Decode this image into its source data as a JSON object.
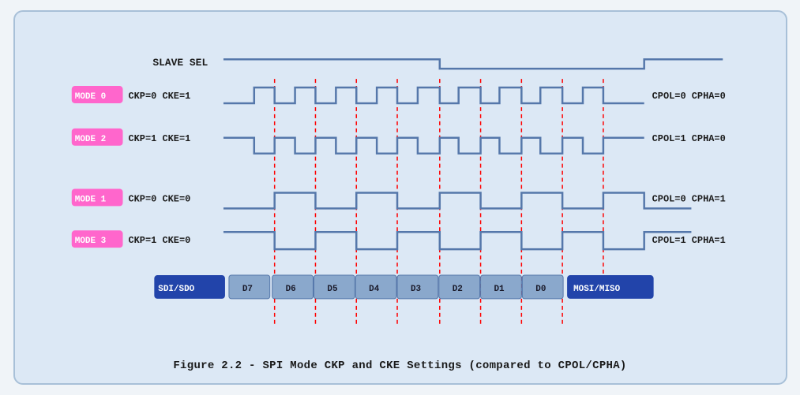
{
  "caption": "Figure 2.2 - SPI Mode CKP and CKE Settings (compared to CPOL/CPHA)",
  "diagram": {
    "slave_sel_label": "SLAVE SEL",
    "mode0_label": "MODE 0",
    "mode0_params": "CKP=0  CKE=1",
    "mode0_right": "CPOL=0  CPHA=0",
    "mode2_label": "MODE 2",
    "mode2_params": "CKP=1  CKE=1",
    "mode2_right": "CPOL=1  CPHA=0",
    "mode1_label": "MODE 1",
    "mode1_params": "CKP=0  CKE=0",
    "mode1_right": "CPOL=0  CPHA=1",
    "mode3_label": "MODE 3",
    "mode3_params": "CKP=1  CKE=0",
    "mode3_right": "CPOL=1  CPHA=1",
    "data_bits": [
      "SDI/SDO",
      "D7",
      "D6",
      "D5",
      "D4",
      "D3",
      "D2",
      "D1",
      "D0",
      "MOSI/MISO"
    ]
  }
}
